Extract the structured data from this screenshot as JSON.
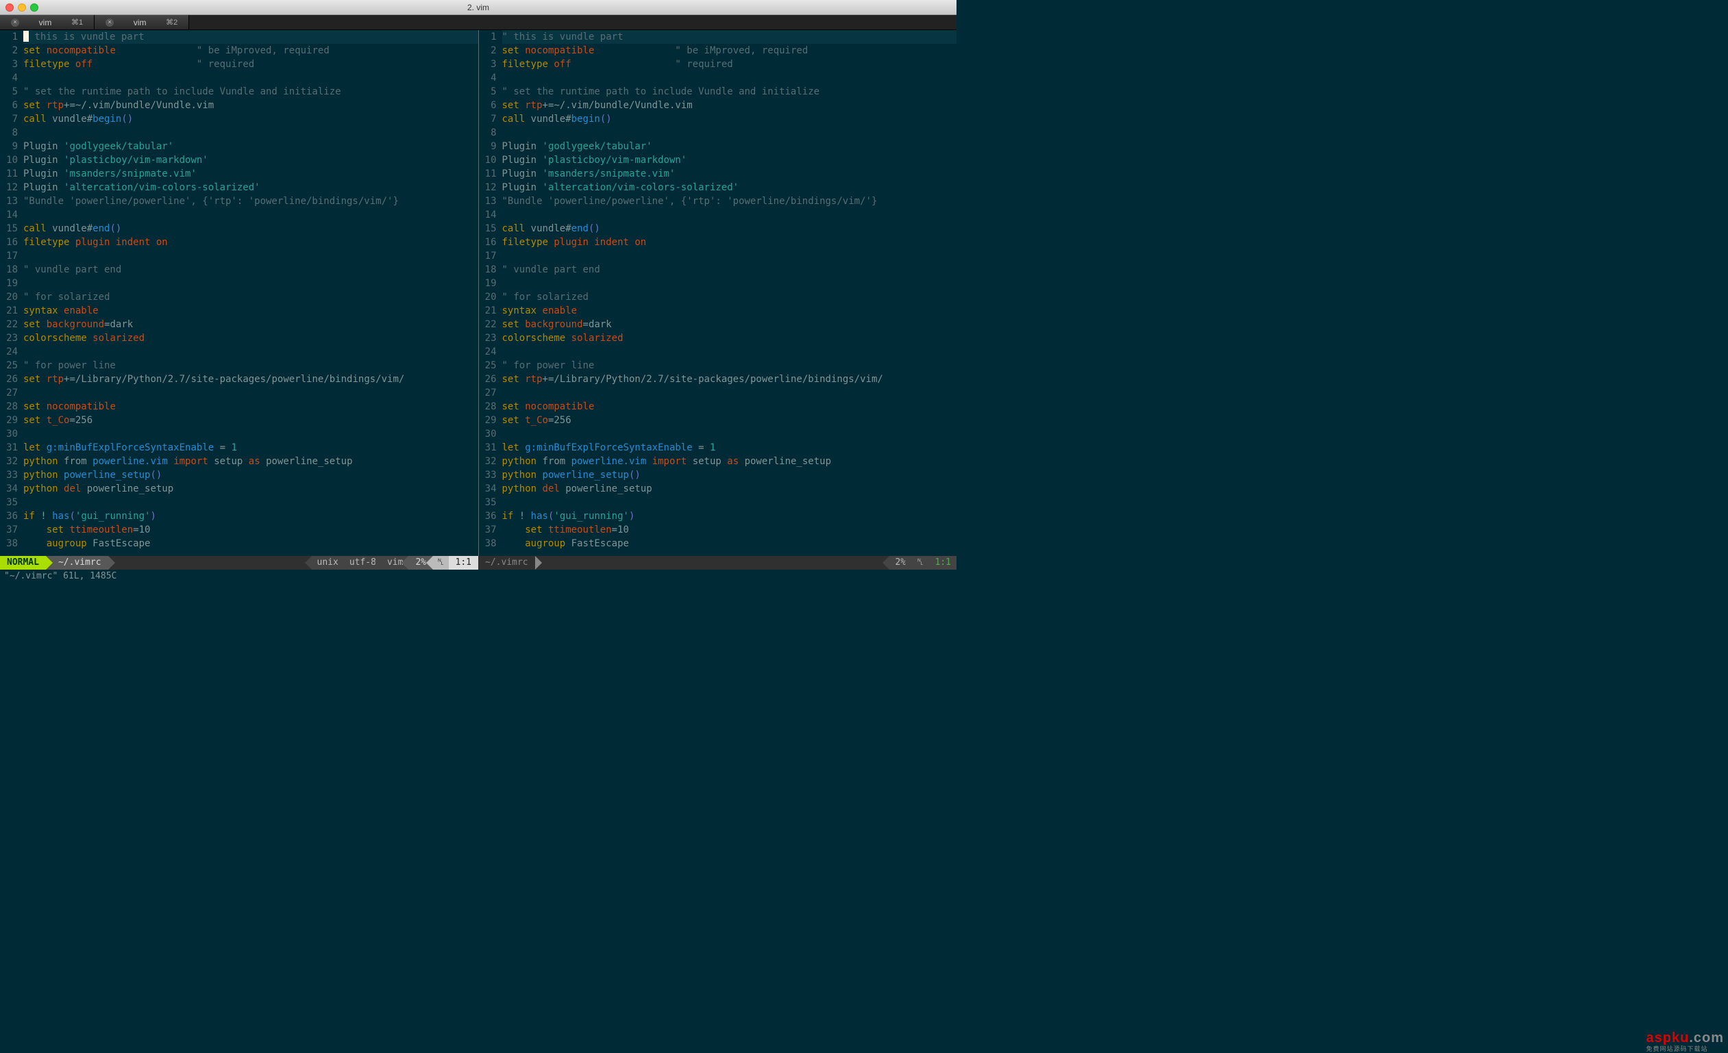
{
  "window": {
    "title": "2. vim"
  },
  "tabs": [
    {
      "label": "vim",
      "shortcut": "⌘1"
    },
    {
      "label": "vim",
      "shortcut": "⌘2"
    }
  ],
  "code_lines": [
    {
      "n": 1,
      "t": "comment",
      "text": "\" this is vundle part"
    },
    {
      "n": 2,
      "t": "set",
      "kw": "set",
      "opt": "nocompatible",
      "rest": "",
      "cmt": "\" be iMproved, required",
      "cmtcol": 30
    },
    {
      "n": 3,
      "t": "set",
      "kw": "filetype",
      "opt": "off",
      "rest": "",
      "cmt": "\" required",
      "cmtcol": 30
    },
    {
      "n": 4,
      "t": "blank"
    },
    {
      "n": 5,
      "t": "comment",
      "text": "\" set the runtime path to include Vundle and initialize"
    },
    {
      "n": 6,
      "t": "set",
      "kw": "set",
      "opt": "rtp",
      "rest": "+=~/.vim/bundle/Vundle.vim"
    },
    {
      "n": 7,
      "t": "call",
      "kw": "call",
      "ns": "vundle#",
      "fn": "begin",
      "paren": "()"
    },
    {
      "n": 8,
      "t": "blank"
    },
    {
      "n": 9,
      "t": "plugin",
      "kw": "Plugin",
      "arg": "'godlygeek/tabular'"
    },
    {
      "n": 10,
      "t": "plugin",
      "kw": "Plugin",
      "arg": "'plasticboy/vim-markdown'"
    },
    {
      "n": 11,
      "t": "plugin",
      "kw": "Plugin",
      "arg": "'msanders/snipmate.vim'"
    },
    {
      "n": 12,
      "t": "plugin",
      "kw": "Plugin",
      "arg": "'altercation/vim-colors-solarized'"
    },
    {
      "n": 13,
      "t": "comment",
      "text": "\"Bundle 'powerline/powerline', {'rtp': 'powerline/bindings/vim/'}"
    },
    {
      "n": 14,
      "t": "blank"
    },
    {
      "n": 15,
      "t": "call",
      "kw": "call",
      "ns": "vundle#",
      "fn": "end",
      "paren": "()"
    },
    {
      "n": 16,
      "t": "ft",
      "kw": "filetype",
      "rest": "plugin indent on"
    },
    {
      "n": 17,
      "t": "blank"
    },
    {
      "n": 18,
      "t": "comment",
      "text": "\" vundle part end"
    },
    {
      "n": 19,
      "t": "blank"
    },
    {
      "n": 20,
      "t": "comment",
      "text": "\" for solarized"
    },
    {
      "n": 21,
      "t": "set",
      "kw": "syntax",
      "opt": "enable"
    },
    {
      "n": 22,
      "t": "set",
      "kw": "set",
      "opt": "background",
      "rest": "=dark"
    },
    {
      "n": 23,
      "t": "set",
      "kw": "colorscheme",
      "opt": "solarized"
    },
    {
      "n": 24,
      "t": "blank"
    },
    {
      "n": 25,
      "t": "comment",
      "text": "\" for power line"
    },
    {
      "n": 26,
      "t": "set",
      "kw": "set",
      "opt": "rtp",
      "rest": "+=/Library/Python/2.7/site-packages/powerline/bindings/vim/"
    },
    {
      "n": 27,
      "t": "blank"
    },
    {
      "n": 28,
      "t": "set",
      "kw": "set",
      "opt": "nocompatible"
    },
    {
      "n": 29,
      "t": "set",
      "kw": "set",
      "opt": "t_Co",
      "rest": "=256"
    },
    {
      "n": 30,
      "t": "blank"
    },
    {
      "n": 31,
      "t": "let",
      "kw": "let",
      "var": "g:minBufExplForceSyntaxEnable",
      "op": " = ",
      "val": "1"
    },
    {
      "n": 32,
      "t": "py",
      "kw": "python",
      "body": "from powerline.vim import setup as powerline_setup",
      "hl": {
        "import": "c-opt",
        "as": "c-opt",
        "powerline.vim": "c-func"
      }
    },
    {
      "n": 33,
      "t": "py",
      "kw": "python",
      "body": "powerline_setup()",
      "call": "powerline_setup"
    },
    {
      "n": 34,
      "t": "py",
      "kw": "python",
      "body": "del powerline_setup",
      "del": "del"
    },
    {
      "n": 35,
      "t": "blank"
    },
    {
      "n": 36,
      "t": "if",
      "kw": "if",
      "body": "! has('gui_running')",
      "fn": "has",
      "str": "'gui_running'"
    },
    {
      "n": 37,
      "t": "set",
      "indent": "    ",
      "kw": "set",
      "opt": "ttimeoutlen",
      "rest": "=10"
    },
    {
      "n": 38,
      "t": "aug",
      "indent": "    ",
      "kw": "augroup",
      "rest": "FastEscape"
    }
  ],
  "statusline": {
    "left": {
      "mode": "NORMAL",
      "file": "~/.vimrc",
      "format": "unix",
      "enc": "utf-8",
      "ft": "vim",
      "pct": "2%",
      "ln_icon": "␤",
      "pos": "1:1"
    },
    "right": {
      "file": "~/.vimrc",
      "pct": "2%",
      "ln_icon": "␤",
      "pos": "1:1"
    }
  },
  "cmdline": "\"~/.vimrc\" 61L, 1485C",
  "watermark": "aspku"
}
